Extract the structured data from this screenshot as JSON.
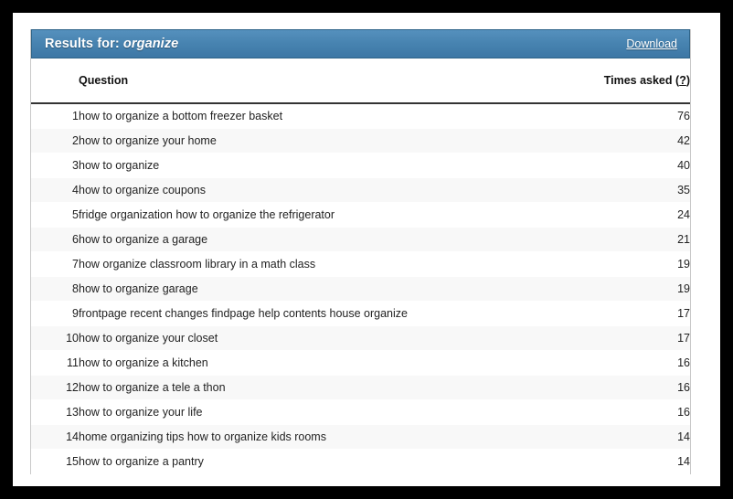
{
  "panel": {
    "title_prefix": "Results for:",
    "query": "organize",
    "download_label": "Download",
    "accent_color": "#4884b1",
    "border_color": "#c9c9c9"
  },
  "table": {
    "columns": {
      "question_header": "Question",
      "count_header": "Times asked",
      "count_header_help": "(?)"
    },
    "rows": [
      {
        "rank": "1",
        "question": "how to organize a bottom freezer basket",
        "count": "76"
      },
      {
        "rank": "2",
        "question": "how to organize your home",
        "count": "42"
      },
      {
        "rank": "3",
        "question": "how to organize",
        "count": "40"
      },
      {
        "rank": "4",
        "question": "how to organize coupons",
        "count": "35"
      },
      {
        "rank": "5",
        "question": "fridge organization how to organize the refrigerator",
        "count": "24"
      },
      {
        "rank": "6",
        "question": "how to organize a garage",
        "count": "21"
      },
      {
        "rank": "7",
        "question": "how organize classroom library in a math class",
        "count": "19"
      },
      {
        "rank": "8",
        "question": "how to organize garage",
        "count": "19"
      },
      {
        "rank": "9",
        "question": "frontpage recent changes findpage help contents house organize",
        "count": "17"
      },
      {
        "rank": "10",
        "question": "how to organize your closet",
        "count": "17"
      },
      {
        "rank": "11",
        "question": "how to organize a kitchen",
        "count": "16"
      },
      {
        "rank": "12",
        "question": "how to organize a tele a thon",
        "count": "16"
      },
      {
        "rank": "13",
        "question": "how to organize your life",
        "count": "16"
      },
      {
        "rank": "14",
        "question": "home organizing tips how to organize kids rooms",
        "count": "14"
      },
      {
        "rank": "15",
        "question": "how to organize a pantry",
        "count": "14"
      }
    ]
  }
}
